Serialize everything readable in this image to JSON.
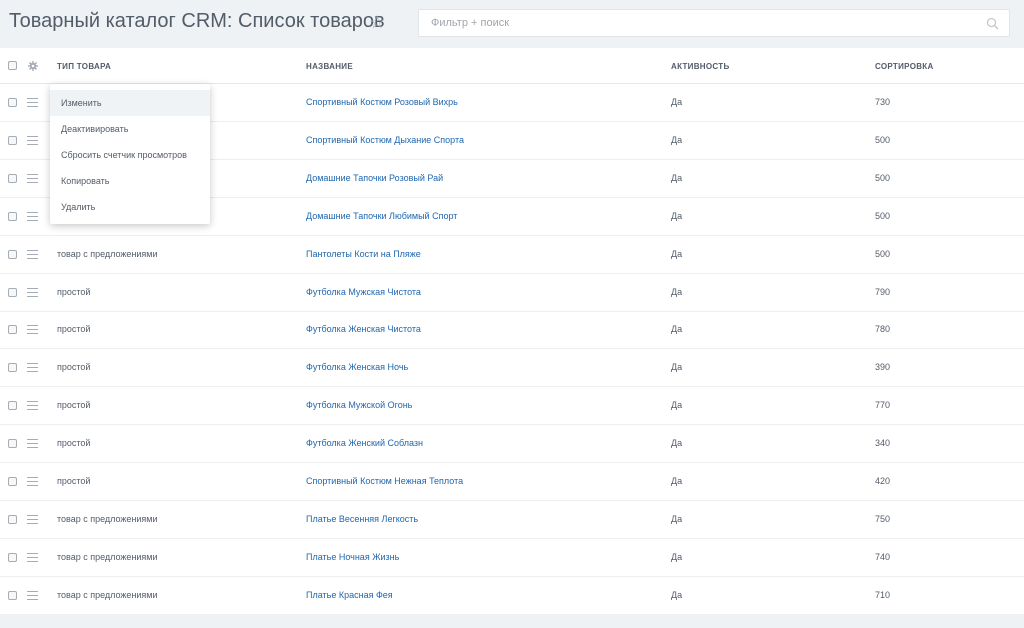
{
  "header": {
    "title": "Товарный каталог CRM: Список товаров",
    "search_placeholder": "Фильтр + поиск"
  },
  "grid": {
    "columns": {
      "type": "ТИП ТОВАРА",
      "name": "НАЗВАНИЕ",
      "active": "АКТИВНОСТЬ",
      "sort": "СОРТИРОВКА"
    },
    "rows": [
      {
        "type": "",
        "name": "Спортивный Костюм Розовый Вихрь",
        "active": "Да",
        "sort": "730"
      },
      {
        "type": "",
        "name": "Спортивный Костюм Дыхание Спорта",
        "active": "Да",
        "sort": "500"
      },
      {
        "type": "",
        "name": "Домашние Тапочки Розовый Рай",
        "active": "Да",
        "sort": "500"
      },
      {
        "type": "",
        "name": "Домашние Тапочки Любимый Спорт",
        "active": "Да",
        "sort": "500"
      },
      {
        "type": "товар с предложениями",
        "name": "Пантолеты Кости на Пляже",
        "active": "Да",
        "sort": "500"
      },
      {
        "type": "простой",
        "name": "Футболка Мужская Чистота",
        "active": "Да",
        "sort": "790"
      },
      {
        "type": "простой",
        "name": "Футболка Женская Чистота",
        "active": "Да",
        "sort": "780"
      },
      {
        "type": "простой",
        "name": "Футболка Женская Ночь",
        "active": "Да",
        "sort": "390"
      },
      {
        "type": "простой",
        "name": "Футболка Мужской Огонь",
        "active": "Да",
        "sort": "770"
      },
      {
        "type": "простой",
        "name": "Футболка Женский Соблазн",
        "active": "Да",
        "sort": "340"
      },
      {
        "type": "простой",
        "name": "Спортивный Костюм Нежная Теплота",
        "active": "Да",
        "sort": "420"
      },
      {
        "type": "товар с предложениями",
        "name": "Платье Весенняя Легкость",
        "active": "Да",
        "sort": "750"
      },
      {
        "type": "товар с предложениями",
        "name": "Платье Ночная Жизнь",
        "active": "Да",
        "sort": "740"
      },
      {
        "type": "товар с предложениями",
        "name": "Платье Красная Фея",
        "active": "Да",
        "sort": "710"
      }
    ]
  },
  "context_menu": {
    "items": [
      "Изменить",
      "Деактивировать",
      "Сбросить счетчик просмотров",
      "Копировать",
      "Удалить"
    ],
    "highlighted": "Изменить"
  }
}
